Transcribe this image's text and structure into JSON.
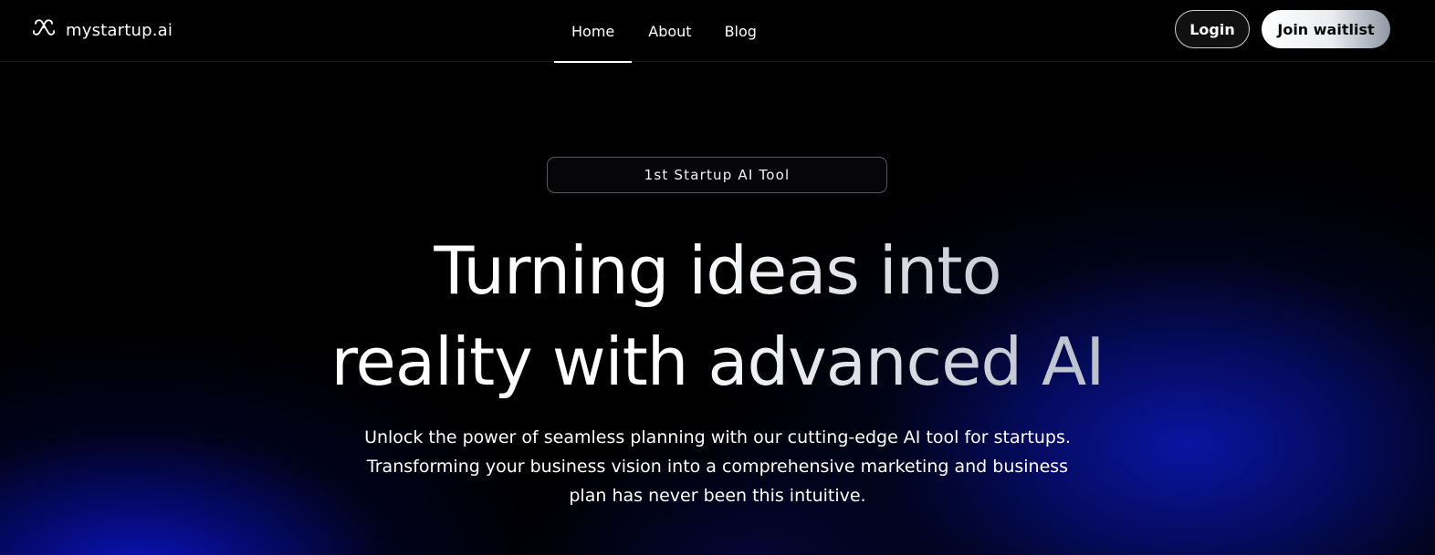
{
  "brand": {
    "name": "mystartup.ai",
    "icon": "link-knot-icon"
  },
  "nav": {
    "items": [
      {
        "label": "Home",
        "active": true
      },
      {
        "label": "About",
        "active": false
      },
      {
        "label": "Blog",
        "active": false
      }
    ]
  },
  "actions": {
    "login_label": "Login",
    "join_label": "Join waitlist"
  },
  "hero": {
    "badge": "1st Startup AI Tool",
    "headline_line1": "Turning ideas into",
    "headline_line2": "reality with advanced AI",
    "subtitle": "Unlock the power of seamless planning with our cutting-edge AI tool for startups. Transforming your business vision into a comprehensive marketing and business plan has never been this intuitive."
  },
  "colors": {
    "background": "#000000",
    "glow_blue": "#0a16aa",
    "text": "#ffffff",
    "join_button_gradient_end": "#8e97a3"
  }
}
